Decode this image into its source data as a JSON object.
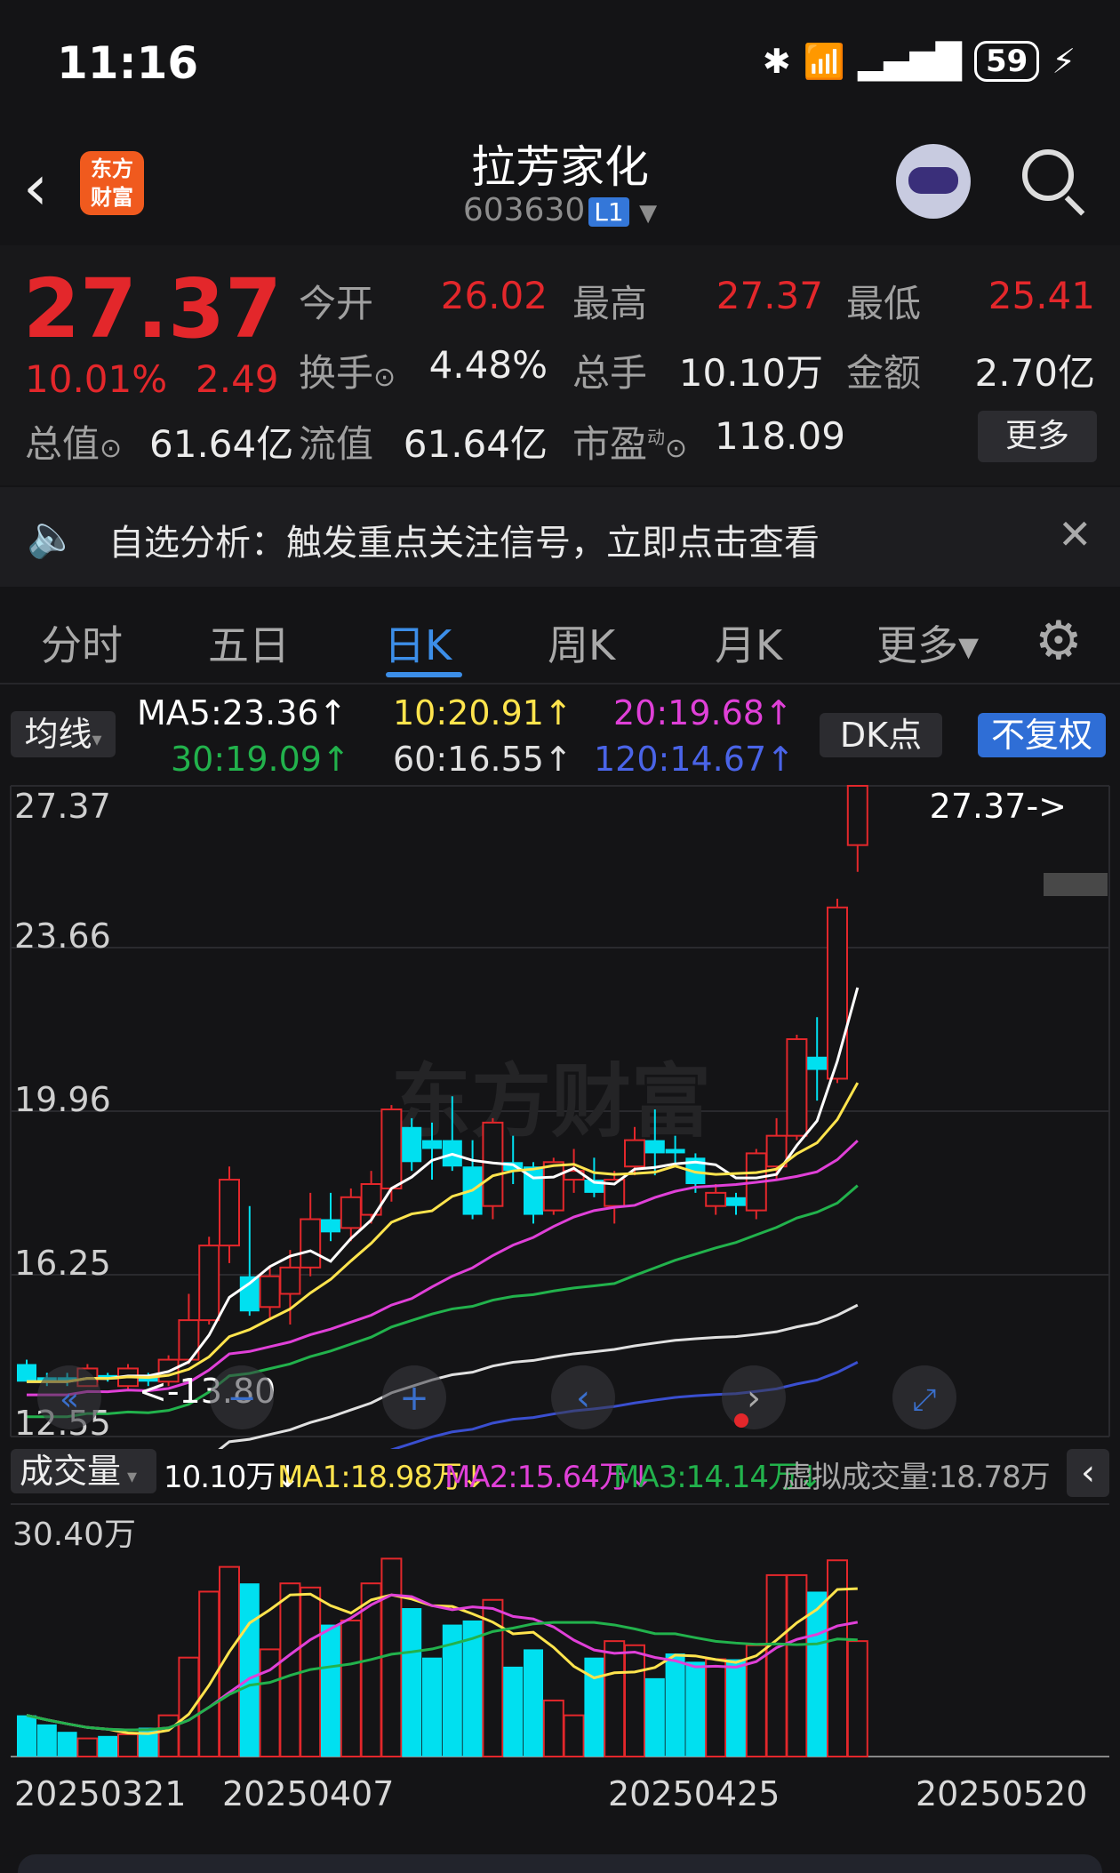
{
  "status_bar": {
    "time": "11:16",
    "battery": "59"
  },
  "header": {
    "title": "拉芳家化",
    "code": "603630",
    "level": "L1"
  },
  "quote": {
    "price": "27.37",
    "change_pct": "10.01%",
    "change": "2.49",
    "open_label": "今开",
    "open": "26.02",
    "high_label": "最高",
    "high": "27.37",
    "low_label": "最低",
    "low": "25.41",
    "turnover_label": "换手",
    "turnover": "4.48%",
    "volume_label": "总手",
    "volume": "10.10万",
    "amount_label": "金额",
    "amount": "2.70亿",
    "mktcap_label": "总值",
    "mktcap": "61.64亿",
    "float_label": "流值",
    "float_cap": "61.64亿",
    "pe_label": "市盈",
    "pe_sup": "动",
    "pe": "118.09",
    "more": "更多"
  },
  "notice": {
    "text": "自选分析：触发重点关注信号，立即点击查看"
  },
  "tabs": [
    {
      "label": "分时"
    },
    {
      "label": "五日"
    },
    {
      "label": "日K"
    },
    {
      "label": "周K"
    },
    {
      "label": "月K"
    },
    {
      "label": "更多▾"
    }
  ],
  "ma_legend": {
    "selector": "均线",
    "ma5": "MA5:23.36↑",
    "ma10": "10:20.91↑",
    "ma20": "20:19.68↑",
    "ma30": "30:19.09↑",
    "ma60": "60:16.55↑",
    "ma120": "120:14.67↑",
    "dk": "DK点",
    "adjust": "不复权",
    "colors": {
      "ma5": "#ffffff",
      "ma10": "#ffe44d",
      "ma20": "#e040d8",
      "ma30": "#22b24c",
      "ma60": "#e0e0e0",
      "ma120": "#3a4fd0"
    }
  },
  "price_axis": {
    "top": "27.37",
    "l2": "23.66",
    "l3": "19.96",
    "l4": "16.25",
    "bottom": "12.55"
  },
  "annotations": {
    "high_mark": "27.37->",
    "low_mark": "<-13.80",
    "watermark": "东方财富"
  },
  "volume_legend": {
    "selector": "成交量",
    "vol": "10.10万↓",
    "ma1": "MA1:18.98万↓",
    "ma2": "MA2:15.64万↓",
    "ma3": "MA3:14.14万↓",
    "virtual": "虚拟成交量:18.78万"
  },
  "volume_axis": {
    "top": "30.40万"
  },
  "dates": {
    "d1": "20250321",
    "d2": "20250407",
    "d3": "20250425",
    "d4": "20250520"
  },
  "chart_data": {
    "type": "candlestick",
    "price_range": [
      12.55,
      27.37
    ],
    "candles": [
      {
        "o": 14.2,
        "c": 13.8,
        "h": 14.3,
        "l": 13.8
      },
      {
        "o": 13.9,
        "c": 13.8,
        "h": 14.0,
        "l": 13.7
      },
      {
        "o": 13.9,
        "c": 13.8,
        "h": 14.0,
        "l": 13.7
      },
      {
        "o": 13.7,
        "c": 14.1,
        "h": 14.2,
        "l": 13.7
      },
      {
        "o": 13.95,
        "c": 13.85,
        "h": 14.0,
        "l": 13.8
      },
      {
        "o": 13.7,
        "c": 14.1,
        "h": 14.2,
        "l": 13.6
      },
      {
        "o": 13.9,
        "c": 13.8,
        "h": 14.0,
        "l": 13.7
      },
      {
        "o": 13.8,
        "c": 14.3,
        "h": 14.4,
        "l": 13.7
      },
      {
        "o": 14.3,
        "c": 15.2,
        "h": 15.8,
        "l": 14.2
      },
      {
        "o": 15.2,
        "c": 16.9,
        "h": 17.1,
        "l": 15.1
      },
      {
        "o": 16.9,
        "c": 18.4,
        "h": 18.7,
        "l": 16.5
      },
      {
        "o": 16.2,
        "c": 15.4,
        "h": 17.8,
        "l": 15.3
      },
      {
        "o": 15.5,
        "c": 16.2,
        "h": 16.4,
        "l": 15.2
      },
      {
        "o": 15.8,
        "c": 16.4,
        "h": 16.8,
        "l": 15.1
      },
      {
        "o": 16.4,
        "c": 17.5,
        "h": 18.1,
        "l": 16.2
      },
      {
        "o": 17.5,
        "c": 17.2,
        "h": 18.1,
        "l": 17.0
      },
      {
        "o": 17.3,
        "c": 18.0,
        "h": 18.2,
        "l": 17.0
      },
      {
        "o": 17.6,
        "c": 18.3,
        "h": 18.6,
        "l": 17.4
      },
      {
        "o": 18.2,
        "c": 20.0,
        "h": 20.1,
        "l": 17.9
      },
      {
        "o": 19.6,
        "c": 18.8,
        "h": 19.8,
        "l": 18.6
      },
      {
        "o": 19.3,
        "c": 19.1,
        "h": 19.7,
        "l": 18.4
      },
      {
        "o": 19.3,
        "c": 18.7,
        "h": 20.3,
        "l": 18.6
      },
      {
        "o": 18.7,
        "c": 17.6,
        "h": 19.3,
        "l": 17.5
      },
      {
        "o": 17.8,
        "c": 19.7,
        "h": 19.8,
        "l": 17.5
      },
      {
        "o": 18.8,
        "c": 18.6,
        "h": 19.4,
        "l": 18.3
      },
      {
        "o": 18.7,
        "c": 17.6,
        "h": 18.8,
        "l": 17.4
      },
      {
        "o": 17.7,
        "c": 18.8,
        "h": 18.9,
        "l": 17.6
      },
      {
        "o": 18.4,
        "c": 18.6,
        "h": 19.1,
        "l": 18.1
      },
      {
        "o": 18.4,
        "c": 18.1,
        "h": 18.9,
        "l": 18.0
      },
      {
        "o": 17.8,
        "c": 18.4,
        "h": 18.6,
        "l": 17.4
      },
      {
        "o": 18.7,
        "c": 19.3,
        "h": 19.6,
        "l": 18.5
      },
      {
        "o": 19.3,
        "c": 19.0,
        "h": 20.0,
        "l": 18.5
      },
      {
        "o": 19.1,
        "c": 19.0,
        "h": 19.4,
        "l": 18.7
      },
      {
        "o": 18.9,
        "c": 18.3,
        "h": 19.0,
        "l": 18.1
      },
      {
        "o": 17.8,
        "c": 18.1,
        "h": 18.3,
        "l": 17.6
      },
      {
        "o": 18.0,
        "c": 17.8,
        "h": 18.1,
        "l": 17.6
      },
      {
        "o": 17.7,
        "c": 19.0,
        "h": 19.1,
        "l": 17.5
      },
      {
        "o": 18.7,
        "c": 19.4,
        "h": 19.8,
        "l": 18.4
      },
      {
        "o": 19.4,
        "c": 21.6,
        "h": 21.7,
        "l": 19.3
      },
      {
        "o": 21.2,
        "c": 20.9,
        "h": 22.1,
        "l": 20.2
      },
      {
        "o": 20.7,
        "c": 24.6,
        "h": 24.8,
        "l": 20.6
      },
      {
        "o": 26.02,
        "c": 27.37,
        "h": 27.37,
        "l": 25.41
      }
    ],
    "volume_max_wan": 30.4,
    "volumes": [
      5,
      3.9,
      3,
      2.2,
      2.5,
      2.7,
      3.5,
      5,
      12,
      20,
      23,
      21,
      13,
      21,
      20.5,
      16,
      16.5,
      21,
      24,
      18,
      12,
      16,
      16.5,
      19,
      10.9,
      13,
      6.8,
      5,
      12,
      14,
      13.5,
      9.5,
      12.5,
      11.5,
      11.8,
      11.8,
      13.5,
      22,
      22,
      20,
      23.8,
      14
    ]
  }
}
